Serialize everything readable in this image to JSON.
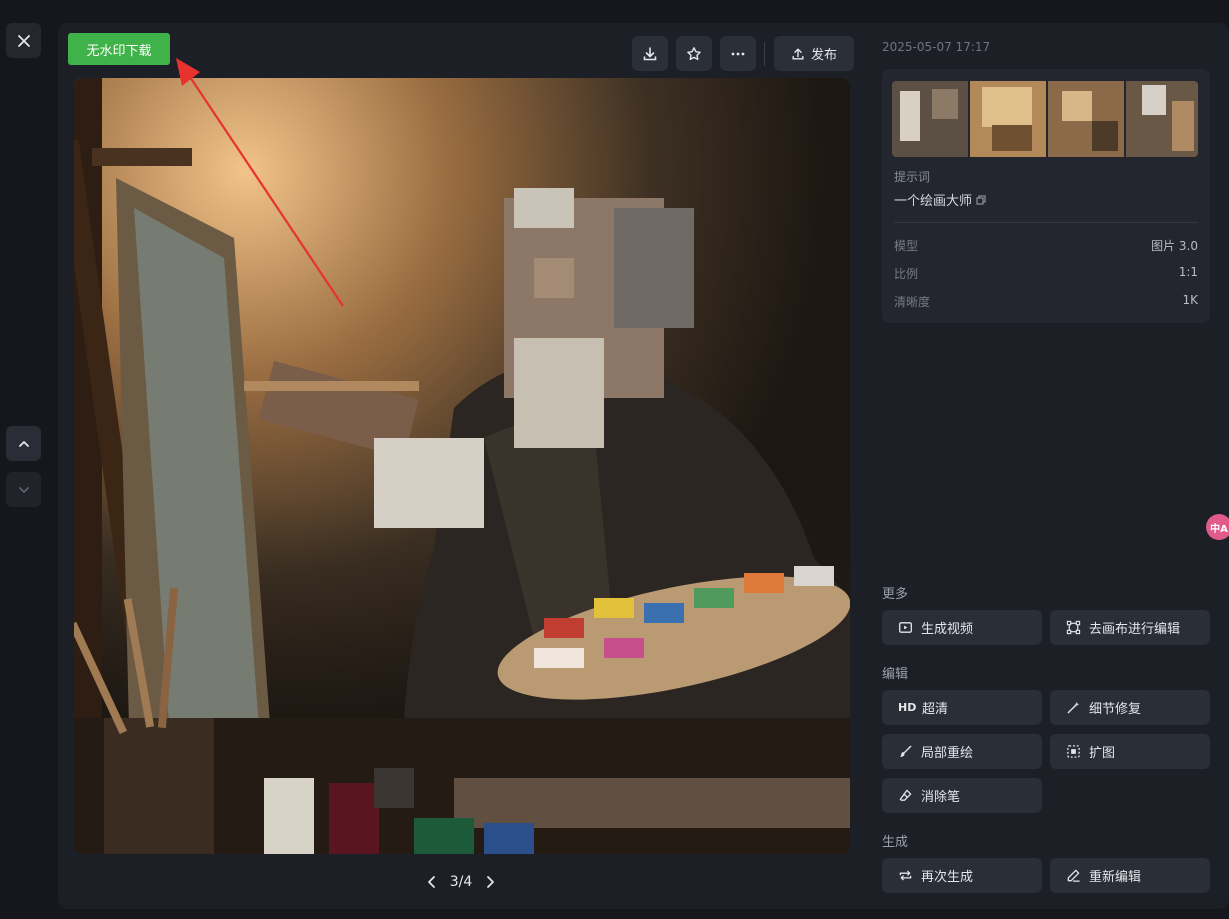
{
  "close_icon": "close-icon",
  "watermark_free_download": "无水印下载",
  "toolbar": {
    "download_icon": "download-icon",
    "favorite_icon": "star-icon",
    "more_icon": "more-icon",
    "publish_label": "发布"
  },
  "pager": {
    "text": "3/4"
  },
  "timestamp": "2025-05-07 17:17",
  "info": {
    "prompt_label": "提示词",
    "prompt_text": "一个绘画大师",
    "rows": [
      {
        "key": "模型",
        "value": "图片 3.0"
      },
      {
        "key": "比例",
        "value": "1:1"
      },
      {
        "key": "清晰度",
        "value": "1K"
      }
    ]
  },
  "sections": {
    "more": {
      "title": "更多",
      "buttons": [
        {
          "label": "生成视频",
          "icon": "video-icon"
        },
        {
          "label": "去画布进行编辑",
          "icon": "canvas-icon"
        }
      ]
    },
    "edit": {
      "title": "编辑",
      "buttons": [
        {
          "label": "超清",
          "icon": "hd-icon"
        },
        {
          "label": "细节修复",
          "icon": "wand-icon"
        },
        {
          "label": "局部重绘",
          "icon": "brush-icon"
        },
        {
          "label": "扩图",
          "icon": "expand-icon"
        },
        {
          "label": "消除笔",
          "icon": "eraser-icon"
        }
      ]
    },
    "generate": {
      "title": "生成",
      "buttons": [
        {
          "label": "再次生成",
          "icon": "repeat-icon"
        },
        {
          "label": "重新编辑",
          "icon": "pen-icon"
        }
      ]
    }
  },
  "hd_text": "HD",
  "badge_text": "中A"
}
